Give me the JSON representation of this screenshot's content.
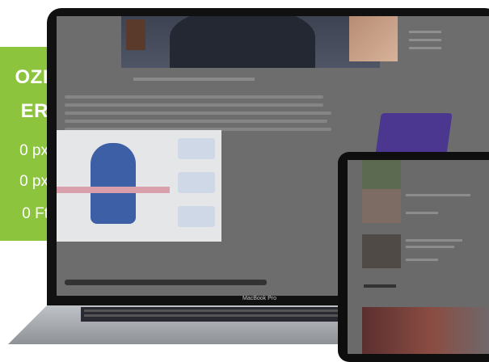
{
  "promo": {
    "title_line1": "OZI",
    "title_line2": "ER",
    "spec1": "0 px",
    "spec2": "0 px",
    "spec3": "0 Ft",
    "color": "#8cc43e"
  },
  "laptop": {
    "brand_label": "MacBook Pro"
  }
}
